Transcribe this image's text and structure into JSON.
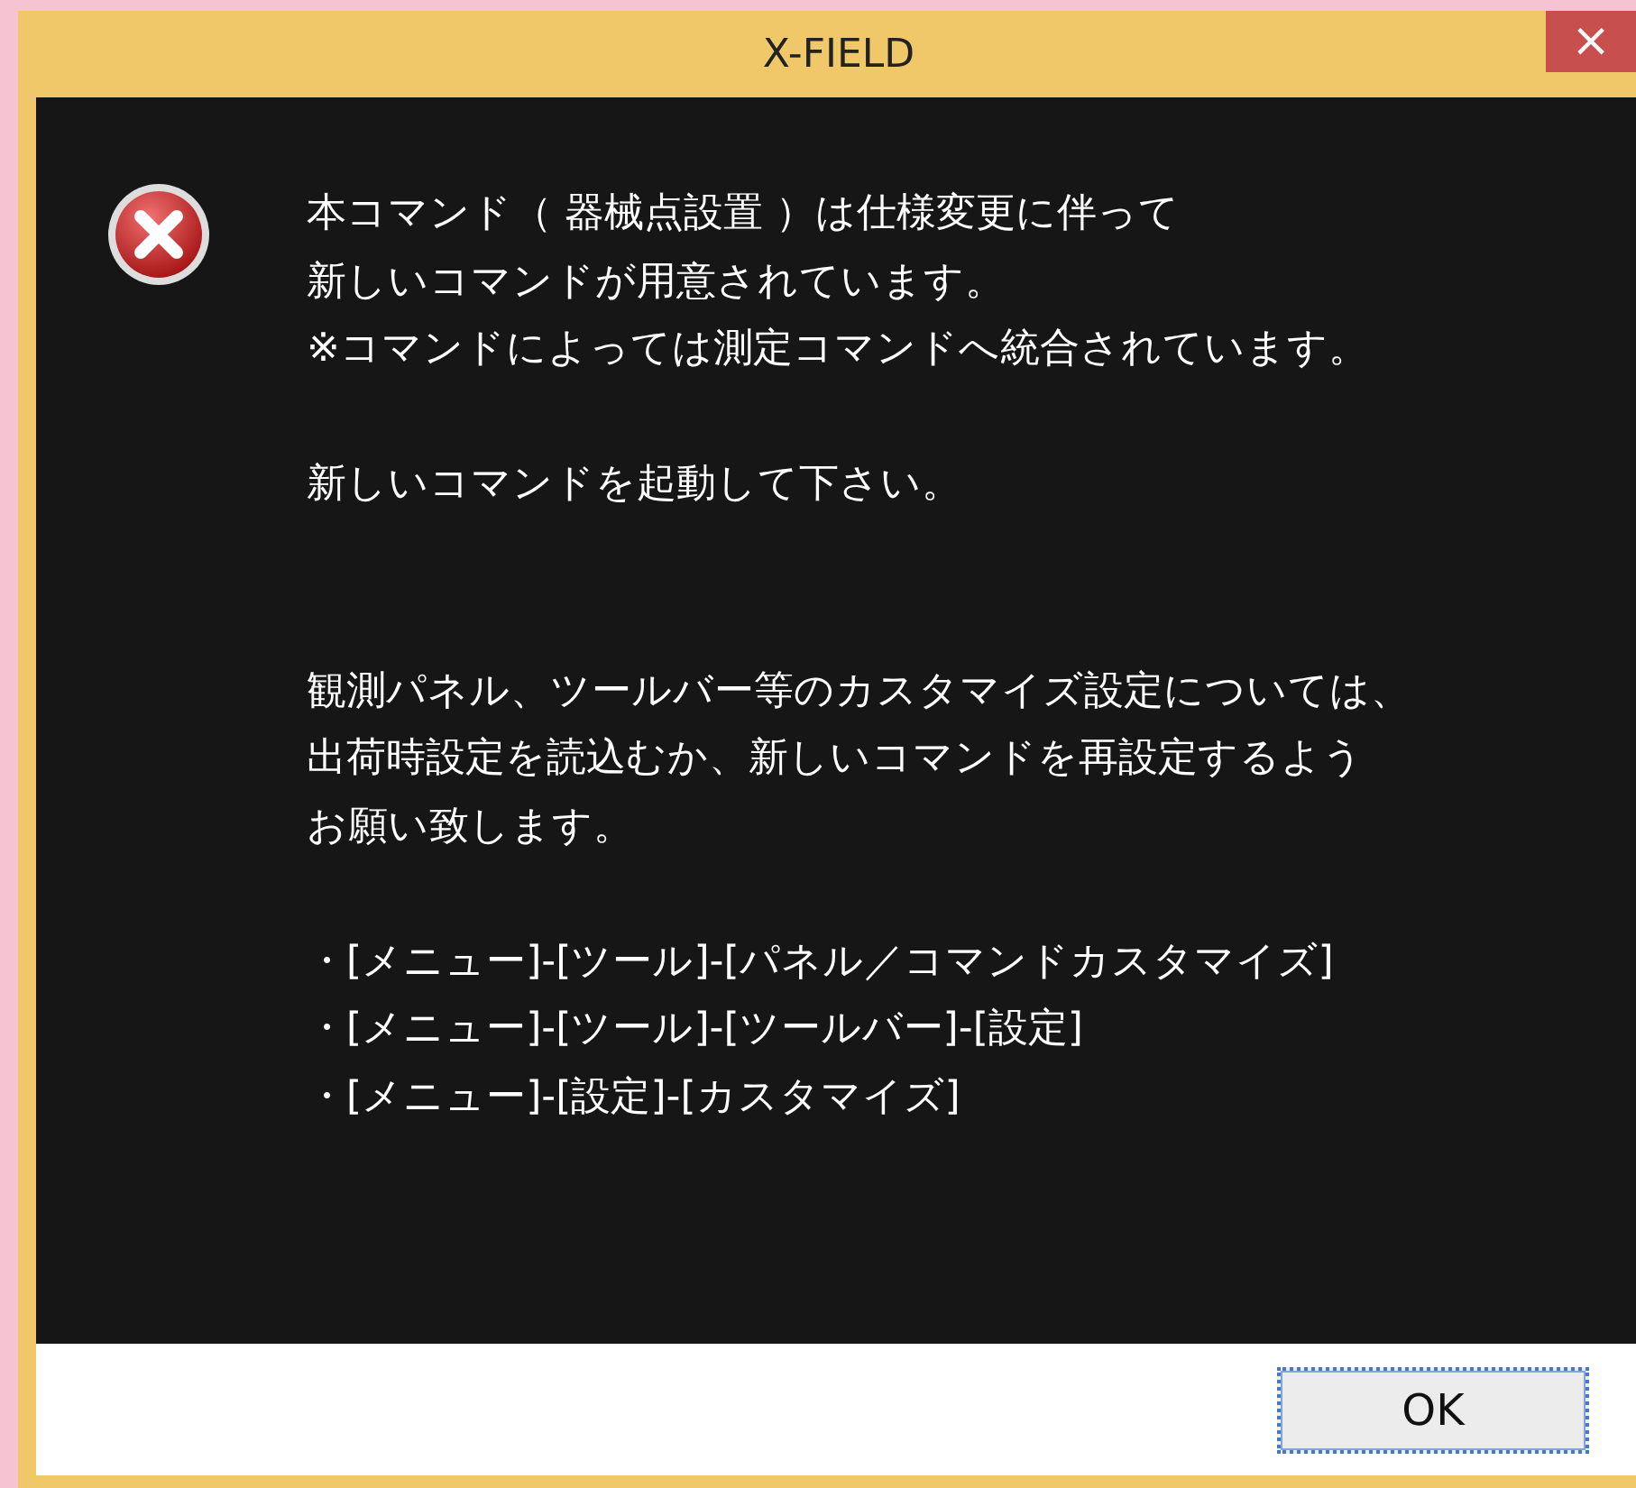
{
  "window": {
    "title": "X-FIELD",
    "close": "×"
  },
  "message": {
    "paragraphs": [
      {
        "lines": [
          "本コマンド（ 器械点設置 ）は仕様変更に伴って",
          "新しいコマンドが用意されています。",
          "※コマンドによっては測定コマンドへ統合されています。"
        ]
      },
      {
        "lines": [
          "新しいコマンドを起動して下さい。"
        ]
      },
      {
        "lines": [
          "観測パネル、ツールバー等のカスタマイズ設定については、",
          "出荷時設定を読込むか、新しいコマンドを再設定するよう",
          "お願い致します。"
        ]
      }
    ],
    "menu_paths": [
      "・[メニュー]-[ツール]-[パネル／コマンドカスタマイズ]",
      "・[メニュー]-[ツール]-[ツールバー]-[設定]",
      "・[メニュー]-[設定]-[カスタマイズ]"
    ]
  },
  "buttons": [
    {
      "label": "OK",
      "focused": true
    }
  ]
}
